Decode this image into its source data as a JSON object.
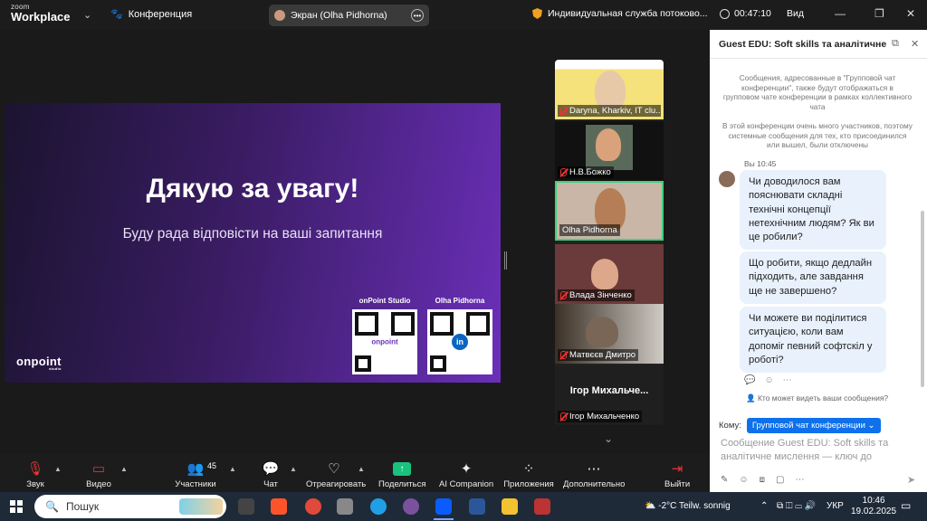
{
  "topbar": {
    "brand_small": "zoom",
    "brand": "Workplace",
    "conference_label": "Конференция",
    "screen_label": "Экран (Olha Pidhorna)",
    "stream_label": "Индивидуальная служба потоково...",
    "timer": "00:47:10",
    "view_label": "Вид"
  },
  "slide": {
    "title": "Дякую за увагу!",
    "subtitle": "Буду рада відповісти на ваші запитання",
    "qr1_label": "onPoint Studio",
    "qr1_center": "onpoint",
    "qr2_label": "Olha Pidhorna",
    "qr2_center": "in",
    "logo": "onpoint",
    "logo_sub": "studio"
  },
  "gallery": {
    "tiles": [
      {
        "name": "Daryna, Kharkiv, IT clu..."
      },
      {
        "name": "Н.В.Божко"
      },
      {
        "name": "Olha Pidhorna"
      },
      {
        "name": "Влада Зінченко"
      },
      {
        "name": "Матвєєв Дмитро"
      },
      {
        "name": "Ігор Михальченко",
        "big": "Ігор  Михальче..."
      }
    ]
  },
  "toolbar": {
    "audio": "Звук",
    "video": "Видео",
    "participants": "Участники",
    "participants_count": "45",
    "chat": "Чат",
    "react": "Отреагировать",
    "share": "Поделиться",
    "ai": "AI Companion",
    "apps": "Приложения",
    "more": "Дополнительно",
    "leave": "Выйти"
  },
  "chat": {
    "title": "Guest EDU: Soft skills та аналітичне ...",
    "sys1": "Сообщения, адресованные в \"Групповой чат конференции\", также будут отображаться в групповом чате конференции в рамках коллективного чата",
    "sys2": "В этой конференции очень много участников, поэтому системные сообщения для тех, кто присоединился или вышел, были отключены",
    "meta": "Вы 10:45",
    "messages": [
      "Чи доводилося вам пояснювати складні технічні концепції нетехнічним людям? Як ви це робили?",
      "Що робити, якщо дедлайн підходить, але завдання ще не завершено?",
      "Чи можете ви поділитися ситуацією, коли вам допоміг певний софтскіл у роботі?"
    ],
    "who_sees": "Кто может видеть ваши сообщения?",
    "to_label": "Кому:",
    "to_value": "Групповой чат конференции",
    "placeholder": "Сообщение Guest EDU: Soft skills та аналітичне мислення — ключ до"
  },
  "taskbar": {
    "search": "Пошук",
    "weather_temp": "-2°C",
    "weather_text": "Teilw. sonnig",
    "lang": "УКР",
    "time": "10:46",
    "date": "19.02.2025"
  }
}
